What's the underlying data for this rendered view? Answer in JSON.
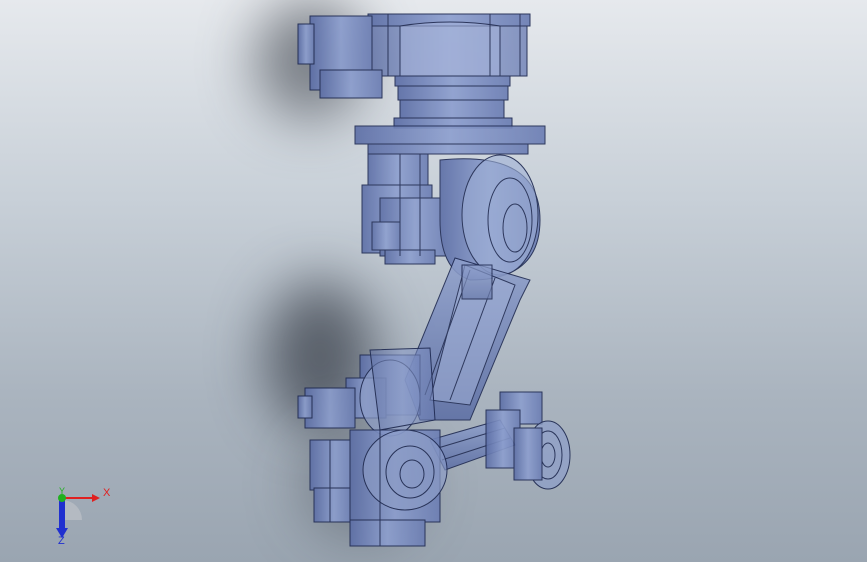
{
  "viewport": {
    "background_top": "#e6e9ed",
    "background_bottom": "#9aa5b1",
    "model_color": "#7d8fbf",
    "edge_color": "#1d2850"
  },
  "triad": {
    "x_label": "X",
    "y_label": "Y",
    "z_label": "Z",
    "x_color": "#e02020",
    "y_color": "#20b020",
    "z_color": "#2030d0"
  }
}
